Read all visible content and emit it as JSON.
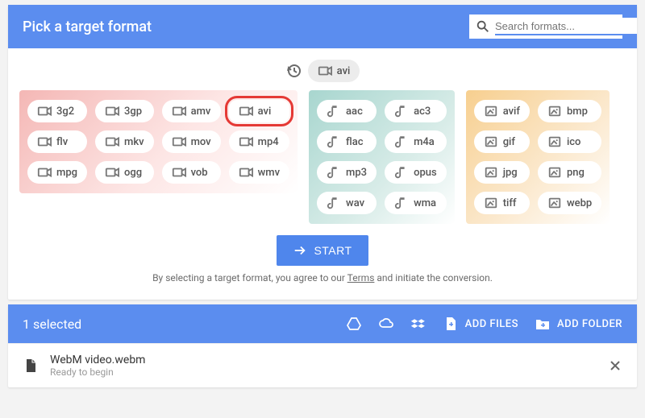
{
  "header": {
    "title": "Pick a target format",
    "search_placeholder": "Search formats..."
  },
  "recent": {
    "label": "avi"
  },
  "groups": {
    "video": [
      "3g2",
      "3gp",
      "amv",
      "avi",
      "flv",
      "mkv",
      "mov",
      "mp4",
      "mpg",
      "ogg",
      "vob",
      "wmv"
    ],
    "audio": [
      "aac",
      "ac3",
      "flac",
      "m4a",
      "mp3",
      "opus",
      "wav",
      "wma"
    ],
    "image": [
      "avif",
      "bmp",
      "gif",
      "ico",
      "jpg",
      "png",
      "tiff",
      "webp"
    ]
  },
  "highlighted": "avi",
  "start_label": "START",
  "agree": {
    "prefix": "By selecting a target format, you agree to our ",
    "link": "Terms",
    "suffix": " and initiate the conversion."
  },
  "toolbar": {
    "selected": "1 selected",
    "add_files": "ADD FILES",
    "add_folder": "ADD FOLDER"
  },
  "file": {
    "name": "WebM video.webm",
    "status": "Ready to begin"
  }
}
